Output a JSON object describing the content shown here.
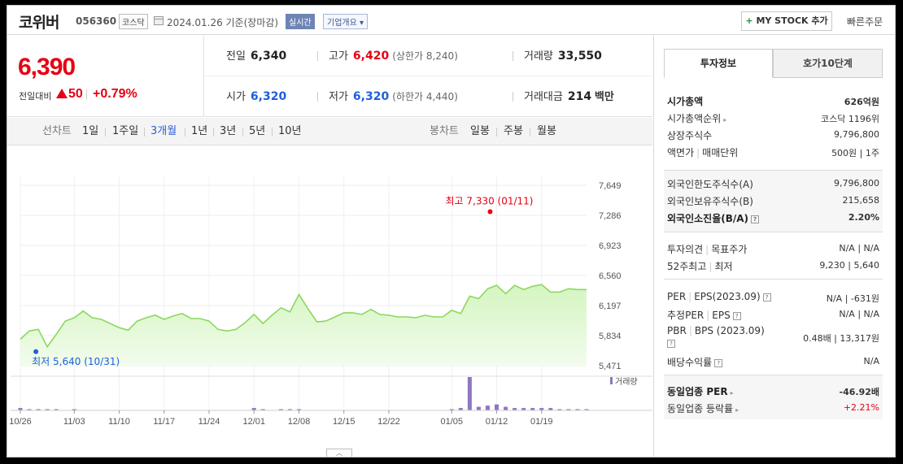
{
  "header": {
    "name": "코위버",
    "code": "056360",
    "market": "코스닥",
    "date": "2024.01.26 기준(장마감)",
    "realtime": "실시간",
    "company_info": "기업개요",
    "mystock": "MY STOCK 추가",
    "quick_order": "빠른주문"
  },
  "price": {
    "current": "6,390",
    "prev_label": "전일대비",
    "change": "50",
    "rate": "+0.79%"
  },
  "summary": {
    "prev_label": "전일",
    "prev": "6,340",
    "high_label": "고가",
    "high": "6,420",
    "upper_limit": "(상한가 8,240)",
    "volume_label": "거래량",
    "volume": "33,550",
    "open_label": "시가",
    "open": "6,320",
    "low_label": "저가",
    "low": "6,320",
    "lower_limit": "(하한가 4,440)",
    "amount_label": "거래대금",
    "amount": "214",
    "amount_unit": "백만"
  },
  "toolbar": {
    "line_chart": "선차트",
    "periods": [
      "1일",
      "1주일",
      "3개월",
      "1년",
      "3년",
      "5년",
      "10년"
    ],
    "active_period": "3개월",
    "candle_chart": "봉차트",
    "candles": [
      "일봉",
      "주봉",
      "월봉"
    ]
  },
  "chart_data": {
    "type": "line",
    "x": [
      "10/26",
      "10/27",
      "10/30",
      "10/31",
      "11/01",
      "11/02",
      "11/03",
      "11/06",
      "11/07",
      "11/08",
      "11/09",
      "11/10",
      "11/13",
      "11/14",
      "11/15",
      "11/16",
      "11/17",
      "11/20",
      "11/21",
      "11/22",
      "11/23",
      "11/24",
      "11/27",
      "11/28",
      "11/29",
      "11/30",
      "12/01",
      "12/04",
      "12/05",
      "12/06",
      "12/07",
      "12/08",
      "12/11",
      "12/12",
      "12/13",
      "12/14",
      "12/15",
      "12/18",
      "12/19",
      "12/20",
      "12/21",
      "12/22",
      "12/26",
      "12/27",
      "12/28",
      "01/02",
      "01/03",
      "01/04",
      "01/05",
      "01/08",
      "01/09",
      "01/10",
      "01/11",
      "01/12",
      "01/15",
      "01/16",
      "01/17",
      "01/18",
      "01/19",
      "01/22",
      "01/23",
      "01/24",
      "01/25",
      "01/26"
    ],
    "values": [
      5790,
      5890,
      5910,
      5700,
      5850,
      6010,
      6050,
      6130,
      6050,
      6030,
      5980,
      5930,
      5900,
      6010,
      6050,
      6080,
      6030,
      6070,
      6100,
      6040,
      6040,
      6010,
      5910,
      5890,
      5910,
      5990,
      6090,
      5980,
      6080,
      6170,
      6120,
      6330,
      6160,
      6000,
      6010,
      6060,
      6110,
      6110,
      6090,
      6150,
      6090,
      6080,
      6060,
      6060,
      6050,
      6080,
      6060,
      6060,
      6140,
      6100,
      6310,
      6280,
      6400,
      6440,
      6340,
      6440,
      6390,
      6430,
      6450,
      6360,
      6360,
      6400,
      6390,
      6390
    ],
    "y_ticks": [
      "7,649",
      "7,286",
      "6,923",
      "6,560",
      "6,197",
      "5,834",
      "5,471"
    ],
    "ylim": [
      5471,
      7649
    ],
    "x_tick_labels": [
      "10/26",
      "11/03",
      "11/10",
      "11/17",
      "11/24",
      "12/01",
      "12/08",
      "12/15",
      "12/22",
      "01/05",
      "01/12",
      "01/19"
    ],
    "high_annotation": "최고 7,330 (01/11)",
    "low_annotation": "최저 5,640 (10/31)",
    "volume_label": "거래량",
    "volume": [
      2,
      1,
      1,
      1,
      1,
      0,
      1,
      0,
      0,
      0,
      0,
      0,
      0,
      0,
      0,
      0,
      0,
      0,
      0,
      0,
      0,
      0,
      0,
      0,
      0,
      0,
      2,
      1,
      0,
      1,
      1,
      1,
      0,
      0,
      0,
      0,
      0,
      0,
      0,
      0,
      0,
      0,
      0,
      0,
      0,
      0,
      0,
      0,
      1,
      2,
      28,
      3,
      4,
      5,
      3,
      2,
      2,
      2,
      2,
      2,
      1,
      1,
      1,
      1
    ]
  },
  "right": {
    "tab_active": "투자정보",
    "tab_other": "호가10단계",
    "market_cap_label": "시가총액",
    "market_cap": "626억원",
    "cap_rank_label": "시가총액순위",
    "cap_rank": "코스닥 1196위",
    "shares_label": "상장주식수",
    "shares": "9,796,800",
    "par_label": "액면가",
    "unit_label": "매매단위",
    "par_unit": "500원 | 1주",
    "foreign_limit_label": "외국인한도주식수(A)",
    "foreign_limit": "9,796,800",
    "foreign_hold_label": "외국인보유주식수(B)",
    "foreign_hold": "215,658",
    "foreign_rate_label": "외국인소진율(B/A)",
    "foreign_rate": "2.20%",
    "opinion_label": "투자의견",
    "target_label": "목표주가",
    "opinion_target": "N/A | N/A",
    "w52_label": "52주최고",
    "w52_low_label": "최저",
    "w52": "9,230 | 5,640",
    "per_label": "PER",
    "eps_label": "EPS(2023.09)",
    "per_eps": "N/A | -631원",
    "est_per_label": "추정PER",
    "est_eps_label": "EPS",
    "est_per_eps": "N/A | N/A",
    "pbr_label": "PBR",
    "bps_label": "BPS (2023.09)",
    "pbr_bps": "0.48배 | 13,317원",
    "div_label": "배당수익률",
    "div": "N/A",
    "ind_per_label": "동일업종 PER",
    "ind_per": "-46.92배",
    "ind_rate_label": "동일업종 등락률",
    "ind_rate": "+2.21%"
  }
}
